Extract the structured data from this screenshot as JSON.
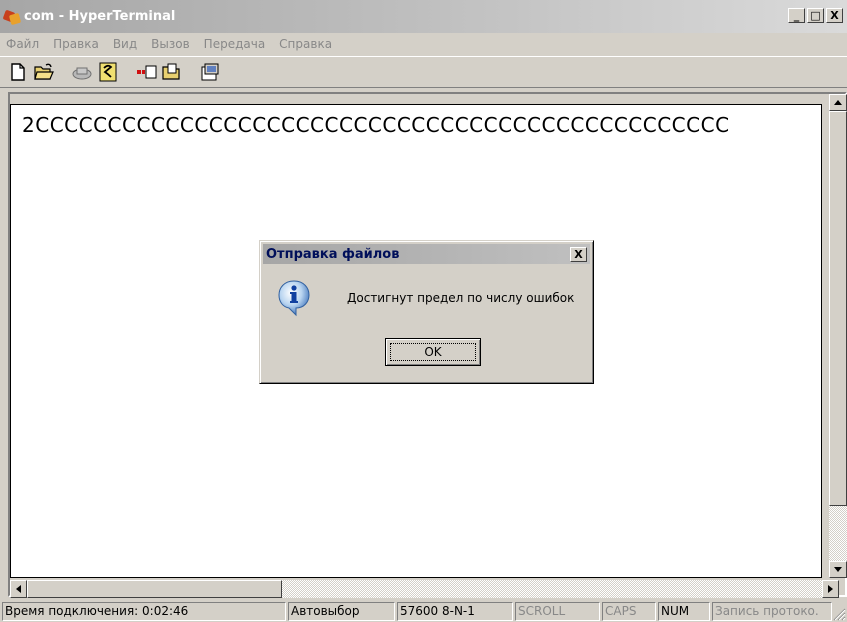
{
  "window": {
    "title": "com - HyperTerminal",
    "controls": {
      "minimize": "_",
      "maximize": "□",
      "close": "X"
    }
  },
  "menu": [
    "Файл",
    "Правка",
    "Вид",
    "Вызов",
    "Передача",
    "Справка"
  ],
  "toolbar": [
    {
      "icon": "new-document-icon"
    },
    {
      "icon": "open-folder-icon"
    },
    {
      "icon": "phone-call-icon"
    },
    {
      "icon": "disconnect-icon"
    },
    {
      "icon": "send-file-icon"
    },
    {
      "icon": "receive-file-icon"
    },
    {
      "icon": "properties-icon"
    }
  ],
  "terminal": {
    "line1": "2CCCCCCCCCCCCCCCCCCCCCCCCCCCCCCCCCCCCCCCCCCCCCCCC"
  },
  "dialog": {
    "title": "Отправка файлов",
    "message": "Достигнут предел по числу ошибок",
    "ok_label": "OK",
    "icon": "info-icon"
  },
  "status": {
    "connect_time": "Время подключения: 0:02:46",
    "detect": "Автовыбор",
    "port_settings": "57600 8-N-1",
    "scroll": "SCROLL",
    "caps": "CAPS",
    "num": "NUM",
    "capture": "Запись протоко."
  },
  "colors": {
    "title_gradient_start": "#a6a6a6",
    "face": "#d4d0c8",
    "terminal_bg": "#ffffff",
    "dialog_title_text": "#000f5a"
  }
}
